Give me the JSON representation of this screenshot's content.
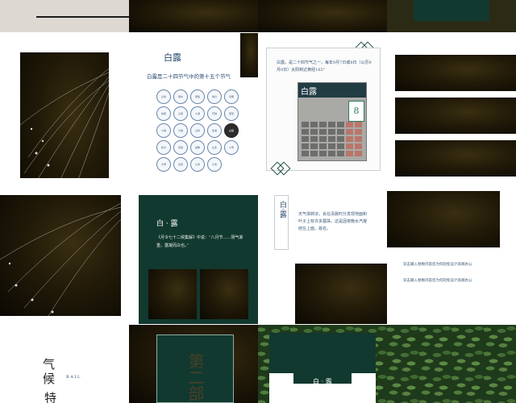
{
  "slide_b": {
    "title": "白露",
    "subtitle": "白露是二十四节气中的第十五个节气",
    "badges": [
      "立春",
      "雨水",
      "惊蛰",
      "春分",
      "清明",
      "谷雨",
      "立夏",
      "小满",
      "芒种",
      "夏至",
      "小暑",
      "大暑",
      "立秋",
      "处暑",
      "白露",
      "秋分",
      "寒露",
      "霜降",
      "立冬",
      "小雪",
      "大雪",
      "冬至",
      "小寒",
      "大寒"
    ],
    "highlight_index": 14
  },
  "slide_c": {
    "text": "白露，是二十四节气之一，每年9月7日或8日（公历9月8日）太阳到达黄经165°",
    "cal_title": "白露",
    "cal_day": "8"
  },
  "slide_f": {
    "heading": "白 · 露",
    "quote": "《月令七十二候集解》中说：“八月节……阴气渐重，露凝而白也。”"
  },
  "slide_g": {
    "vertical_title": "白·露",
    "body": "天气渐转凉，会在清晨时分发现地面和叶子上有许多露珠，这是因夜晚水汽凝结在上面，故名。"
  },
  "slide_h": {
    "line1": "双击输入替换内容您为何轻松设计高端办公",
    "line2": "双击输入替换内容您为何轻松设计高端办公"
  },
  "slide_i": {
    "glyphs": "气候",
    "glyph3": "特",
    "side": "B A I L"
  },
  "slide_j": {
    "vertical": "第二部"
  },
  "slide_k": {
    "heading": "白 · 露"
  }
}
